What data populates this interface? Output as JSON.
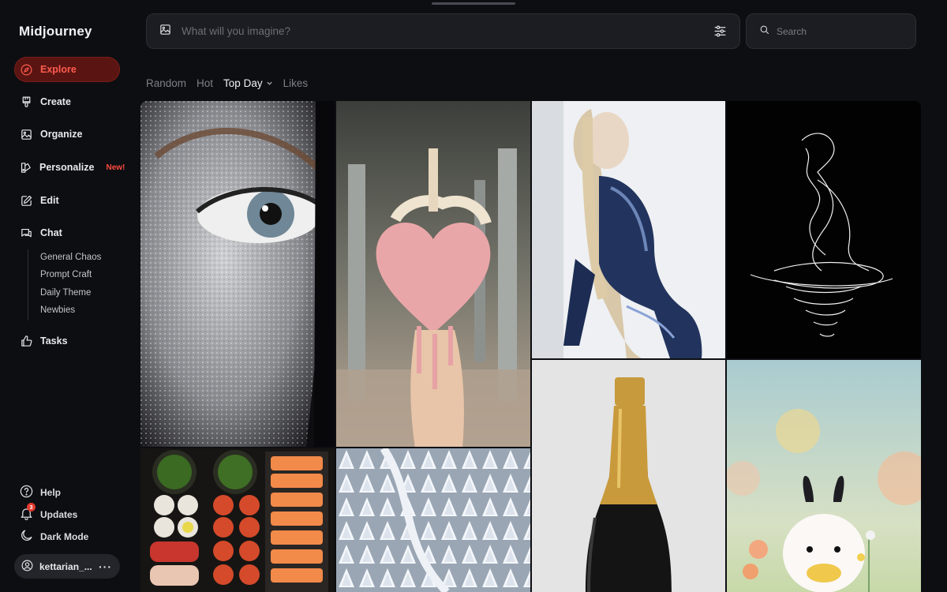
{
  "sidebar": {
    "logo": "Midjourney",
    "nav": [
      {
        "label": "Explore",
        "icon": "compass-icon",
        "active": true
      },
      {
        "label": "Create",
        "icon": "paintbrush-icon"
      },
      {
        "label": "Organize",
        "icon": "image-icon"
      },
      {
        "label": "Personalize",
        "icon": "palette-icon",
        "badge": "New!"
      },
      {
        "label": "Edit",
        "icon": "edit-icon"
      },
      {
        "label": "Chat",
        "icon": "chat-icon"
      },
      {
        "label": "Tasks",
        "icon": "thumbs-up-icon"
      }
    ],
    "chat_rooms": [
      "General Chaos",
      "Prompt Craft",
      "Daily Theme",
      "Newbies"
    ],
    "bottom": {
      "help": "Help",
      "updates": "Updates",
      "updates_count": "3",
      "dark_mode": "Dark Mode"
    },
    "user": {
      "name": "kettarian_...",
      "more": "···"
    }
  },
  "topbar": {
    "prompt_placeholder": "What will you imagine?",
    "search_placeholder": "Search"
  },
  "filters": {
    "tabs": [
      {
        "label": "Random"
      },
      {
        "label": "Hot"
      },
      {
        "label": "Top Day",
        "active": true,
        "dropdown": true
      },
      {
        "label": "Likes"
      }
    ]
  },
  "gallery": {
    "images": [
      {
        "name": "glitter-eye-portrait"
      },
      {
        "name": "pink-heart-in-hand"
      },
      {
        "name": "woman-blue-latex-suit"
      },
      {
        "name": "line-art-figure"
      },
      {
        "name": "sushi-platter"
      },
      {
        "name": "snowy-forest-aerial"
      },
      {
        "name": "champagne-bottle"
      },
      {
        "name": "fluffy-bunny-flowers"
      }
    ]
  },
  "colors": {
    "background": "#0d0e12",
    "accent": "#ff5b4f",
    "accent_bg": "#5a1512",
    "panel": "#1c1d22"
  }
}
